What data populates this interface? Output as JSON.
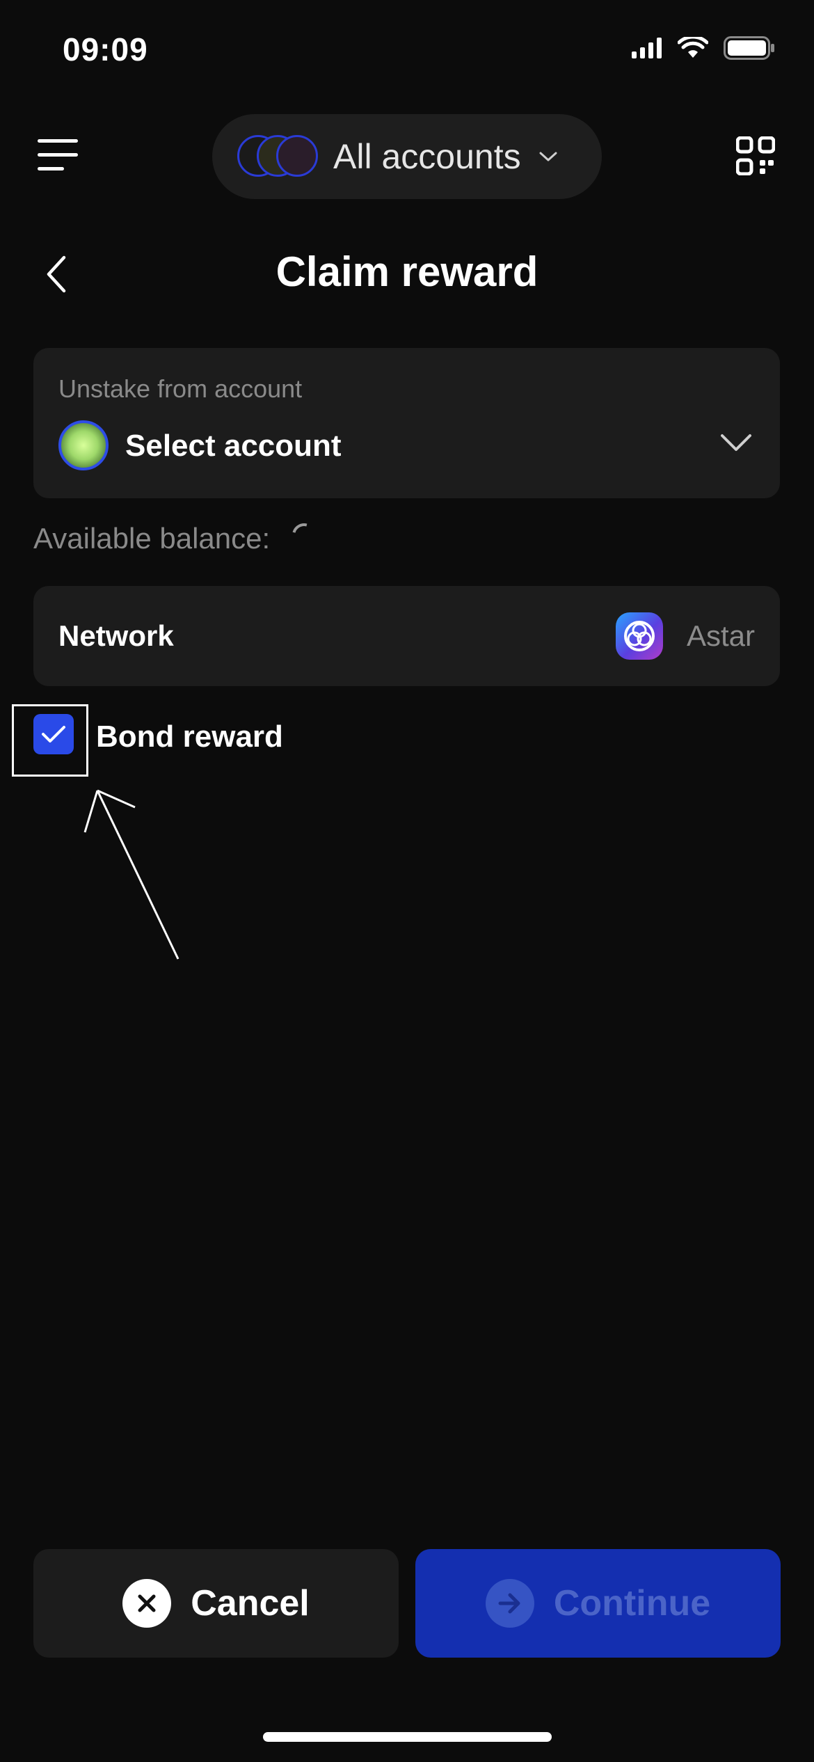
{
  "status_bar": {
    "time": "09:09",
    "icons": [
      "signal-icon",
      "wifi-icon",
      "battery-icon"
    ]
  },
  "header": {
    "menu_icon": "menu-icon",
    "account_selector_label": "All accounts",
    "account_selector_icon": "chevron-down-icon",
    "qr_icon": "qr-code-icon"
  },
  "page": {
    "back_icon": "chevron-left-icon",
    "title": "Claim reward"
  },
  "account_field": {
    "caption": "Unstake from account",
    "value": "Select account"
  },
  "balance": {
    "label": "Available balance:"
  },
  "network_field": {
    "label": "Network",
    "value": "Astar"
  },
  "bond_reward": {
    "label": "Bond reward",
    "checked": true
  },
  "actions": {
    "cancel_label": "Cancel",
    "continue_label": "Continue"
  },
  "colors": {
    "background": "#0c0c0c",
    "card": "#1c1c1c",
    "accent": "#2a4ae8",
    "continue_disabled": "#142fb0"
  }
}
